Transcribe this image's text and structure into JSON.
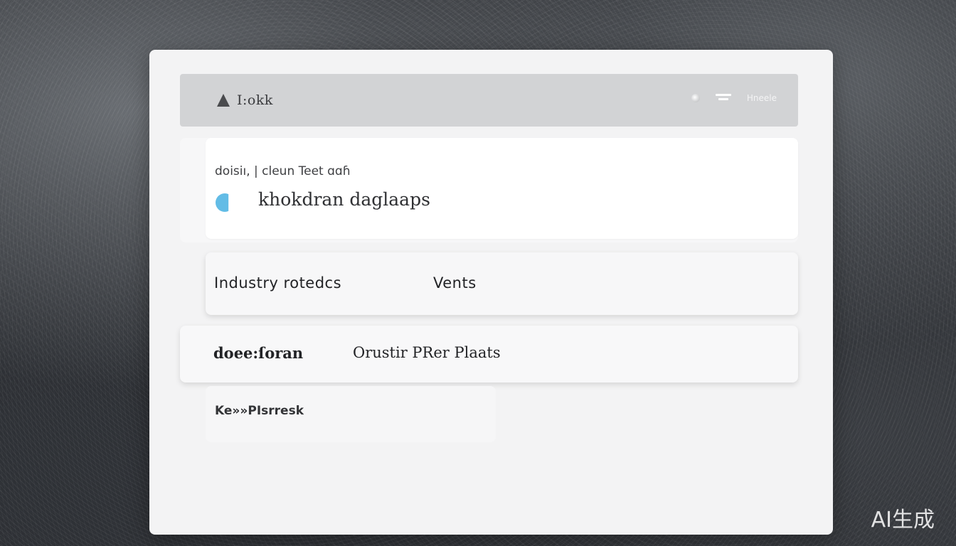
{
  "header": {
    "brand_title": "I:okk",
    "link_label": "Hneele"
  },
  "hero": {
    "subtitle": "doisiı, | cleun Teet ɑɑɦ",
    "headline": "khokdran daglaaps"
  },
  "rows": [
    {
      "col1": "Industry  rotedcs",
      "col2": "Vents"
    },
    {
      "col1": "doee:ſoran",
      "col2": "Orustir PRer Plaats"
    }
  ],
  "small_card": {
    "label": "Ke»»PIsrresk"
  },
  "watermark": "AI生成",
  "colors": {
    "accent": "#62bce6",
    "header_bg": "#d2d3d5",
    "window_bg": "#f3f3f4"
  }
}
